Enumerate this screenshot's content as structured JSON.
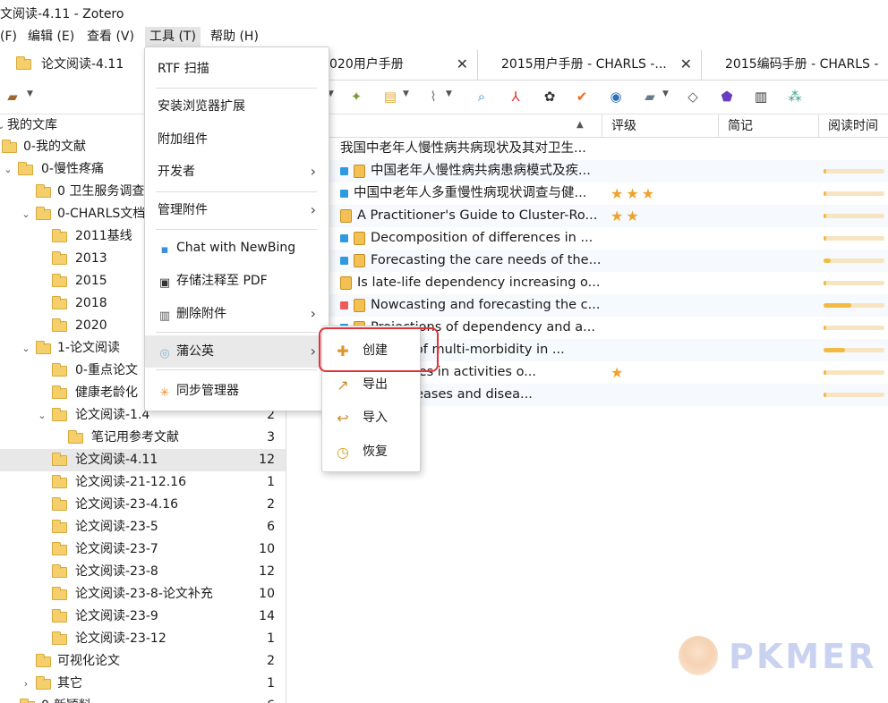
{
  "window": {
    "title": "文阅读-4.11 - Zotero"
  },
  "menubar": [
    {
      "label": "(F)"
    },
    {
      "label": "编辑 (E)"
    },
    {
      "label": "查看 (V)"
    },
    {
      "label": "工具 (T)"
    },
    {
      "label": "帮助 (H)"
    }
  ],
  "tabs": [
    {
      "label": "论文阅读-4.11"
    },
    {
      "label": "020用户手册"
    },
    {
      "label": "2015用户手册 - CHARLS -..."
    },
    {
      "label": "2015编码手册 - CHARLS -"
    }
  ],
  "sidebar": {
    "rows": [
      {
        "label": "我的文库",
        "count": ""
      },
      {
        "label": "0-我的文献",
        "count": ""
      },
      {
        "label": "0-慢性疼痛",
        "count": ""
      },
      {
        "label": "0 卫生服务调查",
        "count": ""
      },
      {
        "label": "0-CHARLS文档",
        "count": ""
      },
      {
        "label": "2011基线",
        "count": ""
      },
      {
        "label": "2013",
        "count": ""
      },
      {
        "label": "2015",
        "count": ""
      },
      {
        "label": "2018",
        "count": ""
      },
      {
        "label": "2020",
        "count": ""
      },
      {
        "label": "1-论文阅读",
        "count": ""
      },
      {
        "label": "0-重点论文",
        "count": ""
      },
      {
        "label": "健康老龄化",
        "count": ""
      },
      {
        "label": "论文阅读-1.4",
        "count": "2"
      },
      {
        "label": "笔记用参考文献",
        "count": "3"
      },
      {
        "label": "论文阅读-4.11",
        "count": "12"
      },
      {
        "label": "论文阅读-21-12.16",
        "count": "1"
      },
      {
        "label": "论文阅读-23-4.16",
        "count": "2"
      },
      {
        "label": "论文阅读-23-5",
        "count": "6"
      },
      {
        "label": "论文阅读-23-7",
        "count": "10"
      },
      {
        "label": "论文阅读-23-8",
        "count": "12"
      },
      {
        "label": "论文阅读-23-8-论文补充",
        "count": "10"
      },
      {
        "label": "论文阅读-23-9",
        "count": "14"
      },
      {
        "label": "论文阅读-23-12",
        "count": "1"
      },
      {
        "label": "可视化论文",
        "count": "2"
      },
      {
        "label": "其它",
        "count": "1"
      },
      {
        "label": "0-新颖料",
        "count": "6"
      }
    ]
  },
  "columns": {
    "rating": "评级",
    "notes": "简记",
    "readtime": "阅读时间"
  },
  "items": [
    {
      "title": "我国中老年人慢性病共病现状及其对卫生...",
      "square": "",
      "notebook": false,
      "stars": "",
      "progress": null
    },
    {
      "title": "中国老年人慢性病共病患病模式及疾...",
      "square": "#2f9ae0",
      "notebook": true,
      "stars": "",
      "progress": 0.04
    },
    {
      "title": "中国中老年人多重慢性病现状调查与健...",
      "square": "#2f9ae0",
      "notebook": false,
      "stars": "★★★",
      "progress": 0.0
    },
    {
      "title": "A Practitioner's Guide to Cluster-Ro...",
      "square": "",
      "notebook": true,
      "stars": "★★",
      "progress": 0.0
    },
    {
      "title": "Decomposition of differences in ...",
      "square": "#2f9ae0",
      "notebook": true,
      "stars": "",
      "progress": 0.0
    },
    {
      "title": "Forecasting the care needs of the...",
      "square": "#2f9ae0",
      "notebook": true,
      "stars": "",
      "progress": 0.12
    },
    {
      "title": "Is late-life dependency increasing o...",
      "square": "",
      "notebook": true,
      "stars": "",
      "progress": 0.0
    },
    {
      "title": "Nowcasting and forecasting the c...",
      "square": "#f05a5a",
      "notebook": true,
      "stars": "",
      "progress": 0.45
    },
    {
      "title": "Projections of dependency and a...",
      "square": "#2f9ae0",
      "notebook": true,
      "stars": "",
      "progress": 0.0
    },
    {
      "title": "Projections of multi-morbidity in ...",
      "square": "",
      "notebook": false,
      "stars": "",
      "progress": 0.36
    },
    {
      "title": "...y disabilities in activities o...",
      "square": "",
      "notebook": false,
      "stars": "★",
      "progress": 0.0
    },
    {
      "title": "...hronic diseases and disea...",
      "square": "",
      "notebook": false,
      "stars": "",
      "progress": 0.0
    }
  ],
  "tools_menu": {
    "rtf": "RTF 扫描",
    "browser": "安装浏览器扩展",
    "addons": "附加组件",
    "developer": "开发者",
    "attachments": "管理附件",
    "newbing": "Chat with NewBing",
    "save_pdf": "存储注释至 PDF",
    "delete_att": "删除附件",
    "dandelion": "蒲公英",
    "sync": "同步管理器"
  },
  "submenu": {
    "create": "创建",
    "export": "导出",
    "import": "导入",
    "restore": "恢复"
  },
  "watermark": {
    "text": "PKMER"
  }
}
